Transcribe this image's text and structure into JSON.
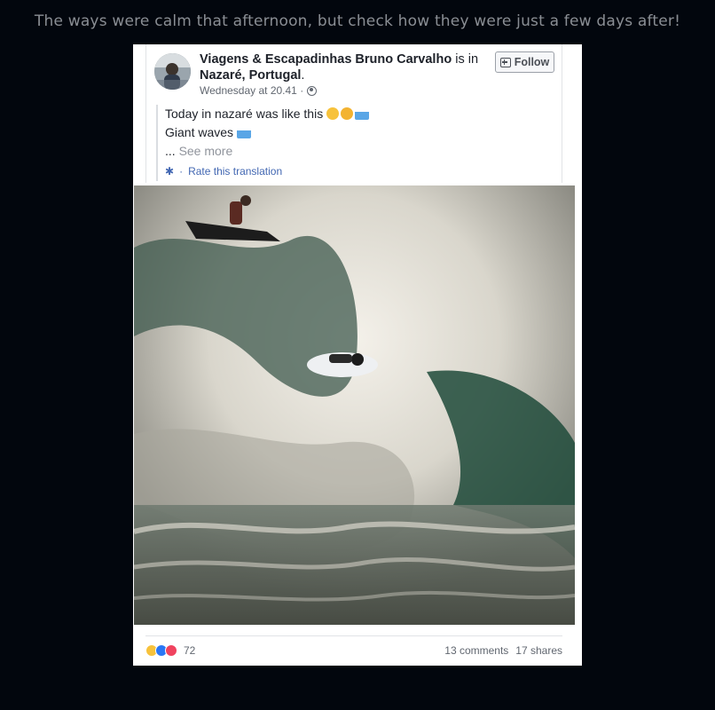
{
  "caption": "The ways were calm that afternoon, but check how they were just a few days after!",
  "post": {
    "author": "Viagens & Escapadinhas Bruno Carvalho",
    "is_in": " is in ",
    "location": "Nazaré, Portugal",
    "location_suffix": ".",
    "timestamp": "Wednesday at 20.41 ·",
    "follow_label": "Follow",
    "line1": "Today in nazaré was like this",
    "line2": "Giant waves",
    "see_more_prefix": "... ",
    "see_more": "See more",
    "rate_prefix": "·",
    "rate_translation": "Rate this translation"
  },
  "footer": {
    "reaction_count": "72",
    "comments": "13 comments",
    "shares": "17 shares"
  },
  "colors": {
    "background": "#02060d",
    "link": "#4267b2",
    "text": "#1d2129"
  }
}
